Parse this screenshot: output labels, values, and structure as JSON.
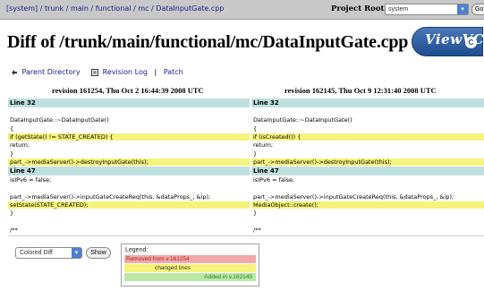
{
  "topbar": {
    "root_link": "[system]",
    "crumbs": [
      "trunk",
      "main",
      "functional",
      "mc",
      "DataInputGate.cpp"
    ],
    "project_root_label": "Project Root:",
    "project_root_value": "system",
    "go_button": "Go"
  },
  "page_title": "Diff of /trunk/main/functional/mc/DataInputGate.cpp",
  "logo_text": "ViewVC",
  "links": {
    "parent": "Parent Directory",
    "revision_log": "Revision Log",
    "patch": "Patch",
    "separator": "|"
  },
  "revisions": {
    "left": "revision 161254, Thu Oct 2 16:44:39 2008 UTC",
    "right": "revision 162145, Thu Oct 9 12:31:40 2008 UTC"
  },
  "diff": [
    {
      "type": "lineno",
      "left": "Line 32",
      "right": "Line 32"
    },
    {
      "type": "ctx",
      "left": "",
      "right": ""
    },
    {
      "type": "ctx",
      "left": "DataInputGate::~DataInputGate()",
      "right": "DataInputGate::~DataInputGate()"
    },
    {
      "type": "ctx",
      "left": "{",
      "right": "{"
    },
    {
      "type": "chg",
      "left": "  if (getState() != STATE_CREATED) {",
      "right": "  if (isCreated()) {"
    },
    {
      "type": "ctx",
      "left": "    return;",
      "right": "    return;"
    },
    {
      "type": "ctx",
      "left": "  }",
      "right": "  }"
    },
    {
      "type": "chg",
      "left": "  part_->mediaServer()->destroyInputGate(this);",
      "right": "  part_->mediaServer()->destroyInputGate(this);"
    },
    {
      "type": "lineno",
      "left": "Line 47",
      "right": "Line 47"
    },
    {
      "type": "ctx",
      "left": "  isIPv6 = false;",
      "right": "  isIPv6 = false;"
    },
    {
      "type": "ctx",
      "left": "",
      "right": ""
    },
    {
      "type": "ctx",
      "left": "  part_->mediaServer()->inputGateCreateReq(this, &dataProps_, &ip);",
      "right": "  part_->mediaServer()->inputGateCreateReq(this, &dataProps_, &ip);"
    },
    {
      "type": "chg",
      "left": "  setState(STATE_CREATED);",
      "right": "  MediaObject::create();"
    },
    {
      "type": "ctx",
      "left": "}",
      "right": "}"
    },
    {
      "type": "ctx",
      "left": "",
      "right": ""
    },
    {
      "type": "ctx",
      "left": "/**",
      "right": "/**"
    }
  ],
  "controls": {
    "format_value": "Colored Diff",
    "show_button": "Show"
  },
  "legend": {
    "title": "Legend:",
    "removed": "Removed from v.161254",
    "changed": "changed lines",
    "added": "Added in v.162145"
  },
  "colors": {
    "lineno_bg": "#bfe1de",
    "changed_bg": "#f6f37c",
    "removed_bg": "#f2a8a8",
    "added_bg": "#b8e8a4",
    "topbar_bg": "#c8c8c8"
  }
}
